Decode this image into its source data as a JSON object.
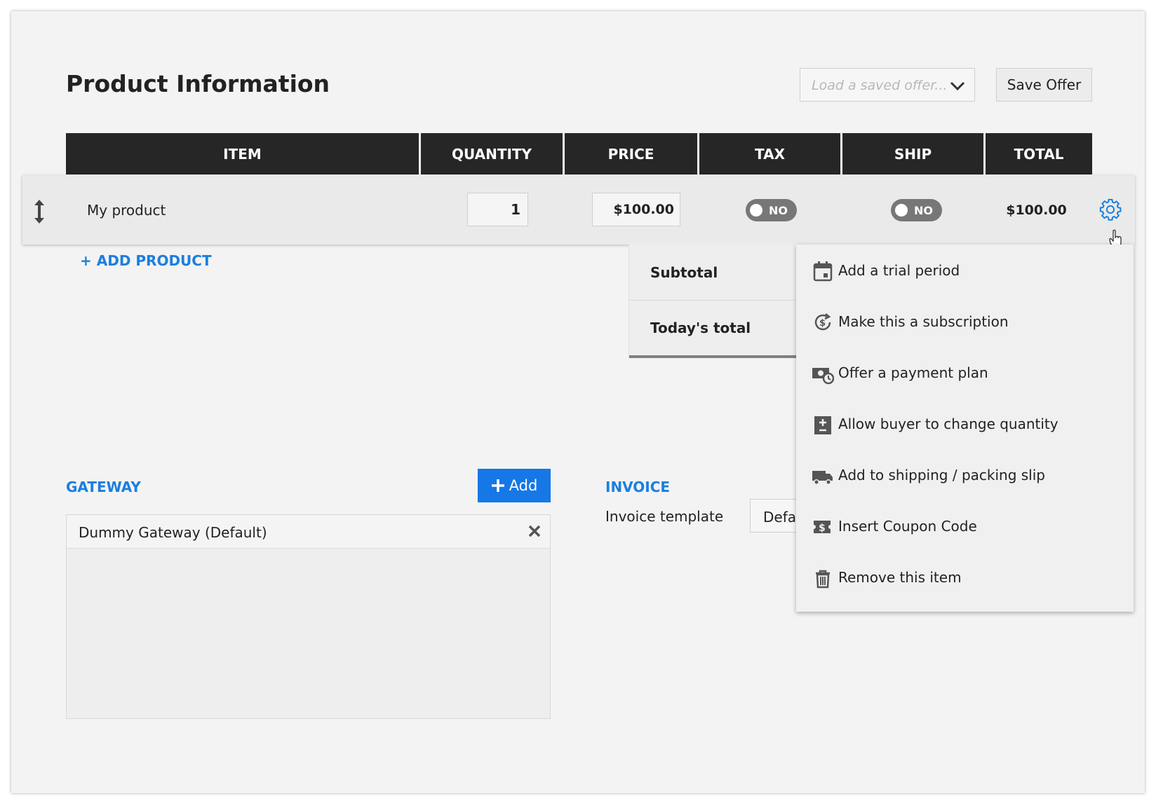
{
  "header": {
    "title": "Product Information",
    "load_placeholder": "Load a saved offer...",
    "save_label": "Save Offer"
  },
  "table": {
    "columns": [
      "ITEM",
      "QUANTITY",
      "PRICE",
      "TAX",
      "SHIP",
      "TOTAL"
    ],
    "row": {
      "name": "My product",
      "quantity": "1",
      "price": "$100.00",
      "tax": "NO",
      "ship": "NO",
      "total": "$100.00"
    },
    "add_product": "ADD PRODUCT"
  },
  "totals": {
    "subtotal_label": "Subtotal",
    "today_label": "Today's total"
  },
  "gateway": {
    "label": "GATEWAY",
    "add_label": "Add",
    "items": [
      "Dummy Gateway (Default)"
    ]
  },
  "invoice": {
    "label": "INVOICE",
    "template_label": "Invoice template",
    "template_value": "Defa"
  },
  "menu": {
    "items": [
      {
        "label": "Add a trial period",
        "icon": "calendar-icon"
      },
      {
        "label": "Make this a subscription",
        "icon": "recurring-dollar-icon"
      },
      {
        "label": "Offer a payment plan",
        "icon": "money-clock-icon"
      },
      {
        "label": "Allow buyer to change quantity",
        "icon": "plus-minus-icon"
      },
      {
        "label": "Add to shipping / packing slip",
        "icon": "truck-icon"
      },
      {
        "label": "Insert Coupon Code",
        "icon": "coupon-icon"
      },
      {
        "label": "Remove this item",
        "icon": "trash-icon"
      }
    ]
  },
  "colors": {
    "accent": "#1b7fe0",
    "header_bg": "#262626",
    "toggle_off": "#777777"
  }
}
